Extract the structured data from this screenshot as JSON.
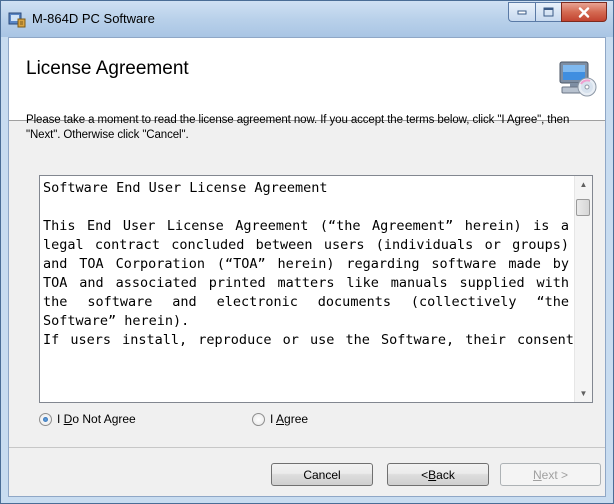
{
  "window": {
    "title": "M-864D PC Software",
    "caption_buttons": [
      "minimize-icon",
      "maximize-icon",
      "close-icon"
    ],
    "close_color": "#c24430"
  },
  "header": {
    "title": "License Agreement",
    "icon": "computer-cd-icon"
  },
  "description": "Please take a moment to read the license agreement now. If you accept the terms below, click \"I Agree\", then \"Next\". Otherwise click \"Cancel\".",
  "license": {
    "heading": "Software End User License Agreement",
    "body": "This End User License Agreement (“the Agreement” herein) is a legal contract concluded between users (individuals or groups) and TOA Corporation (“TOA” herein) regarding software made by TOA and associated printed matters like manuals supplied with the software and electronic documents (collectively “the Software” herein).",
    "body_cutoff": "If users install, reproduce or use the Software, their consent"
  },
  "options": {
    "do_not_agree": {
      "pre": "I ",
      "accel": "D",
      "post": "o Not Agree",
      "selected": true
    },
    "agree": {
      "pre": "I ",
      "accel": "A",
      "post": "gree",
      "selected": false
    }
  },
  "buttons": {
    "cancel": "Cancel",
    "back": {
      "pre": "< ",
      "accel": "B",
      "post": "ack"
    },
    "next": {
      "pre": "",
      "accel": "N",
      "post": "ext >",
      "enabled": false
    }
  }
}
